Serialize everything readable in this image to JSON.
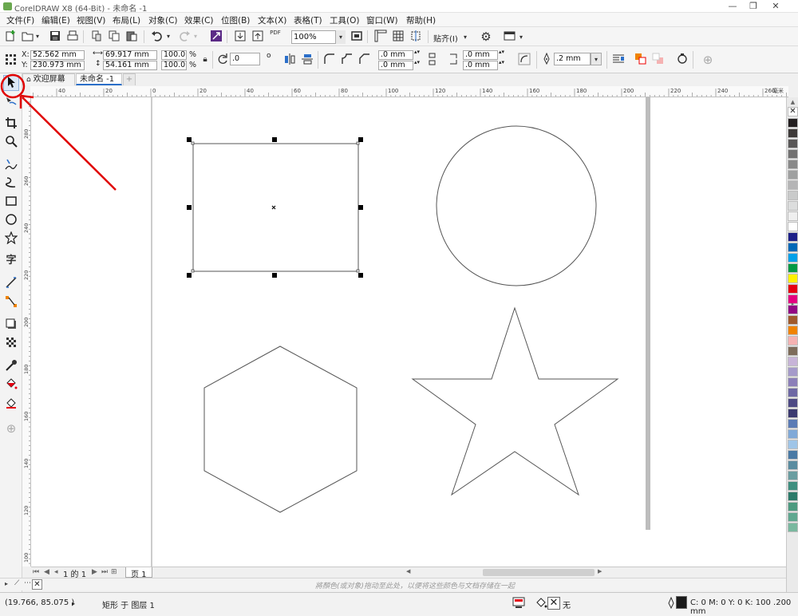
{
  "window": {
    "title": "CorelDRAW X8 (64-Bit) - 未命名 -1",
    "minimize": "—",
    "restore": "❐",
    "close": "✕"
  },
  "menu": [
    "文件(F)",
    "编辑(E)",
    "视图(V)",
    "布局(L)",
    "对象(C)",
    "效果(C)",
    "位图(B)",
    "文本(X)",
    "表格(T)",
    "工具(O)",
    "窗口(W)",
    "帮助(H)"
  ],
  "toolbar": {
    "zoom_value": "100%",
    "pdf_label": "PDF",
    "snap_label": "贴齐(I)"
  },
  "property_bar": {
    "x_label": "X:",
    "x_value": "52.562 mm",
    "y_label": "Y:",
    "y_value": "230.973 mm",
    "width_value": "69.917 mm",
    "height_value": "54.161 mm",
    "scale_x": "100.0",
    "scale_y": "100.0",
    "percent": "%",
    "rotation": ".0",
    "degree": "o",
    "corner_1": ".0 mm",
    "corner_2": ".0 mm",
    "corner_3": ".0 mm",
    "corner_4": ".0 mm",
    "outline_width": ".2 mm"
  },
  "tabs": {
    "welcome": "欢迎屏幕",
    "document": "未命名 -1",
    "add": "+"
  },
  "hruler_ticks": [
    "40",
    "20",
    "0",
    "20",
    "40",
    "60",
    "80",
    "100",
    "120",
    "140",
    "160",
    "180",
    "200",
    "220",
    "240",
    "260"
  ],
  "hruler_unit": "毫米",
  "vruler_ticks": [
    "280",
    "260",
    "240",
    "220",
    "200",
    "180",
    "160",
    "140",
    "120",
    "100"
  ],
  "page_nav": {
    "page_count": "1 的 1",
    "page_tab": "页 1"
  },
  "hint": "將顏色(或对象)拖动至此处，以便将这些颜色与文档存储在一起",
  "status": {
    "coords": "(19.766, 85.075 )",
    "arrow": "▸",
    "object_info": "矩形 于 图层 1",
    "fill_none": "无",
    "outline_info": "C: 0 M: 0 Y: 0 K: 100  .200 mm"
  },
  "palette_colors": [
    "#231f20",
    "#3e3a39",
    "#595757",
    "#727171",
    "#898989",
    "#9fa0a0",
    "#b5b5b6",
    "#c9caca",
    "#dcdddd",
    "#efefef",
    "#ffffff",
    "#1d2088",
    "#0068b7",
    "#00a0e9",
    "#009944",
    "#fff100",
    "#e60012",
    "#e4007f",
    "#920783",
    "#a05a2c",
    "#f08300",
    "#f5b2b2",
    "#7d6c5a",
    "#c7b4d8",
    "#a59aca",
    "#8c7fb9",
    "#6e68a4",
    "#4e4a84",
    "#3c3a70",
    "#5b7bb5",
    "#80a9d8",
    "#9fc5e8",
    "#4a7aa5",
    "#5a8ca0",
    "#6a9da0",
    "#3f8f7f",
    "#2d7b6a",
    "#4d9a80",
    "#60a890",
    "#7ab89f"
  ],
  "accent": "#2b6fc9",
  "annotation_color": "#e00000",
  "icons": [
    "pick-tool-icon",
    "shape-tool-icon",
    "crop-tool-icon",
    "zoom-tool-icon",
    "freehand-tool-icon",
    "artistic-media-icon",
    "rectangle-tool-icon",
    "ellipse-tool-icon",
    "polygon-tool-icon",
    "text-tool-icon",
    "parallel-dimension-icon",
    "connector-tool-icon",
    "drop-shadow-icon",
    "transparency-icon",
    "eyedropper-icon",
    "interactive-fill-icon",
    "smart-fill-icon",
    "add-tool-icon"
  ]
}
